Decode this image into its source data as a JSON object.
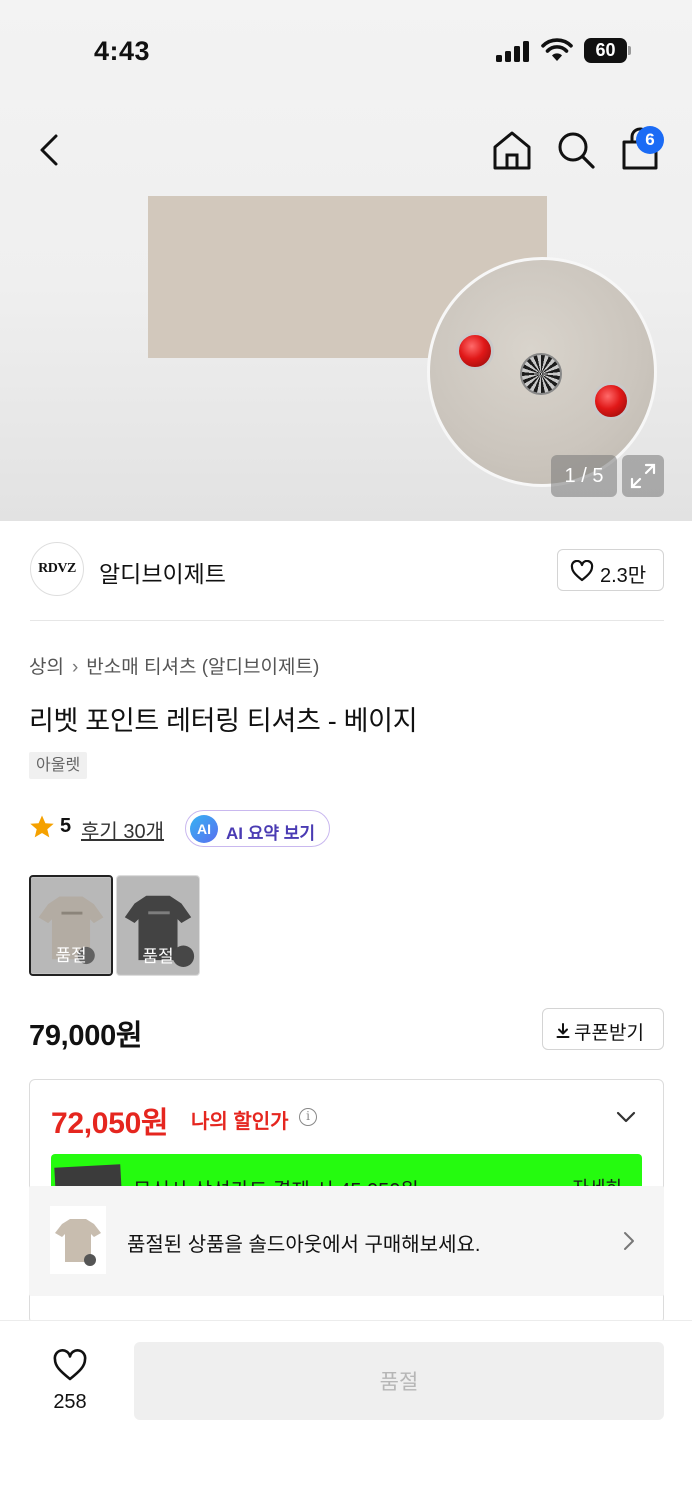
{
  "status_bar": {
    "time": "4:43",
    "battery": "60"
  },
  "header": {
    "cart_count": "6"
  },
  "gallery": {
    "pager": "1 / 5"
  },
  "brand": {
    "logo_text": "RDVZ",
    "name": "알디브이제트",
    "like_count": "2.3만"
  },
  "breadcrumb": {
    "category": "상의",
    "subcategory": "반소매 티셔츠 (알디브이제트)"
  },
  "product": {
    "title": "리벳 포인트 레터링 티셔츠 - 베이지",
    "tag": "아울렛",
    "rating": "5",
    "review_link": "후기 30개",
    "ai_badge": "AI",
    "ai_label": "AI 요약 보기",
    "options": [
      {
        "color": "#c8bdaf",
        "label": "품절"
      },
      {
        "color": "#1d1d1d",
        "label": "품절"
      }
    ],
    "price": "79,000원",
    "coupon_label": "쿠폰받기"
  },
  "discount": {
    "my_price": "72,050원",
    "my_price_label": "나의 할인가",
    "card_promo_text": "무신사 삼성카드 결제 시 45,050원",
    "card_promo_more": "자세히"
  },
  "toast": {
    "text": "품절된 상품을 솔드아웃에서 구매해보세요."
  },
  "bottom_bar": {
    "like_count": "258",
    "buy_label": "품절"
  },
  "colors": {
    "accent_red": "#e5261f",
    "badge_blue": "#1b6bf5",
    "promo_green": "#25fb0f",
    "star": "#f5a100"
  },
  "icons": [
    "back-icon",
    "home-icon",
    "search-icon",
    "cart-icon",
    "expand-icon",
    "heart-icon",
    "star-icon",
    "download-icon",
    "info-icon",
    "chevron-down-icon",
    "chevron-right-icon"
  ]
}
